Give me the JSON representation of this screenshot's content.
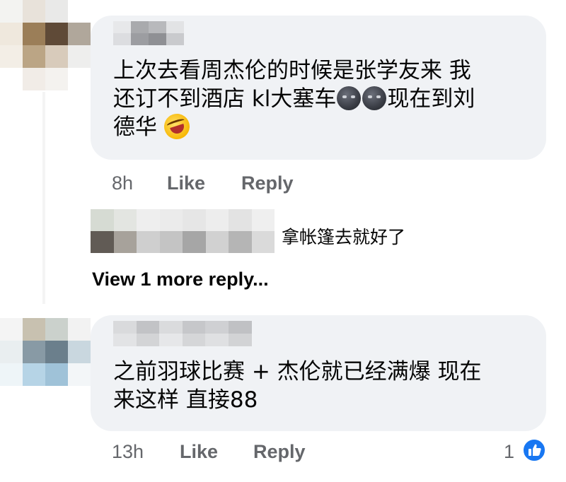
{
  "comments": [
    {
      "text_line1": "上次去看周杰伦的时候是张学友来 我",
      "text_line2_a": "还订不到酒店 kl大塞车",
      "text_line2_b": "现在到刘",
      "text_line3": "德华",
      "time": "8h",
      "like_label": "Like",
      "reply_label": "Reply"
    },
    {
      "text_line1": "之前羽球比赛 + 杰伦就已经满爆 现在",
      "text_line2": "来这样 直接88",
      "time": "13h",
      "like_label": "Like",
      "reply_label": "Reply",
      "reaction_count": "1"
    }
  ],
  "reply": {
    "text": "拿帐篷去就好了",
    "view_more": "View 1 more reply..."
  },
  "icons": {
    "moon_face": "new-moon-face-icon",
    "laughing": "rolling-on-floor-laughing-icon",
    "like": "thumbs-up-icon"
  },
  "colors": {
    "bubble": "#f0f2f5",
    "meta": "#65676b",
    "like_blue": "#1877f2"
  }
}
